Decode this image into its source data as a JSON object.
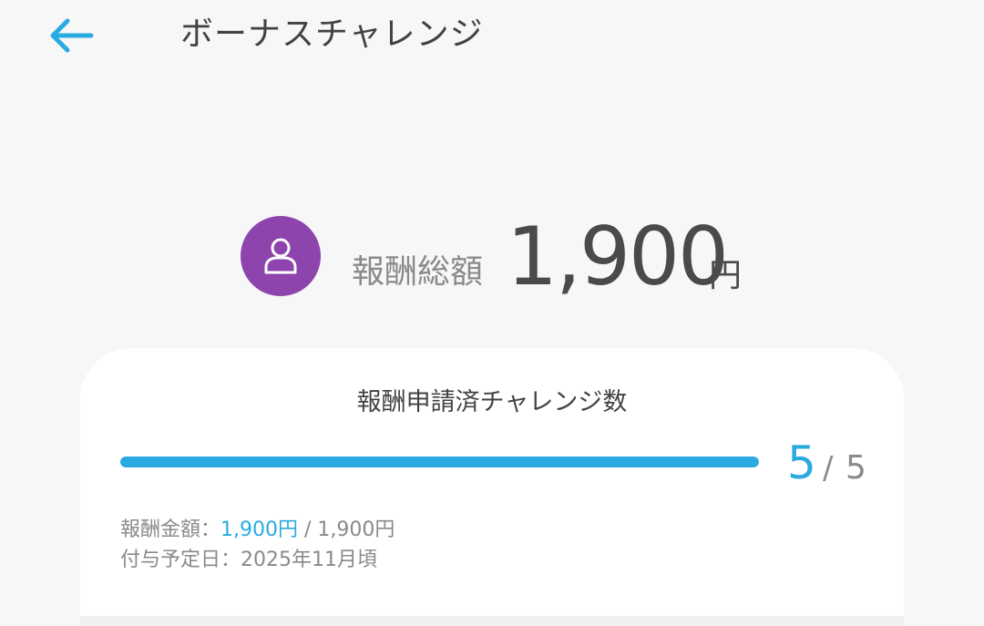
{
  "header": {
    "title": "ボーナスチャレンジ",
    "back_icon": "arrow-left-icon"
  },
  "summary": {
    "avatar_icon": "user-icon",
    "label": "報酬総額",
    "amount": "1,900",
    "unit": "円"
  },
  "card": {
    "title": "報酬申請済チャレンジ数",
    "progress": {
      "current": "5",
      "separator": "/",
      "total": "5",
      "fraction": 1.0
    },
    "reward": {
      "label": "報酬金額：",
      "earned": "1,900円",
      "separator": " / ",
      "max": "1,900円"
    },
    "schedule": {
      "label": "付与予定日：",
      "value": "2025年11月頃"
    }
  },
  "colors": {
    "accent": "#29abe2",
    "avatar_bg": "#8e44ad",
    "text_primary": "#424242",
    "text_secondary": "#8a8a8a"
  }
}
